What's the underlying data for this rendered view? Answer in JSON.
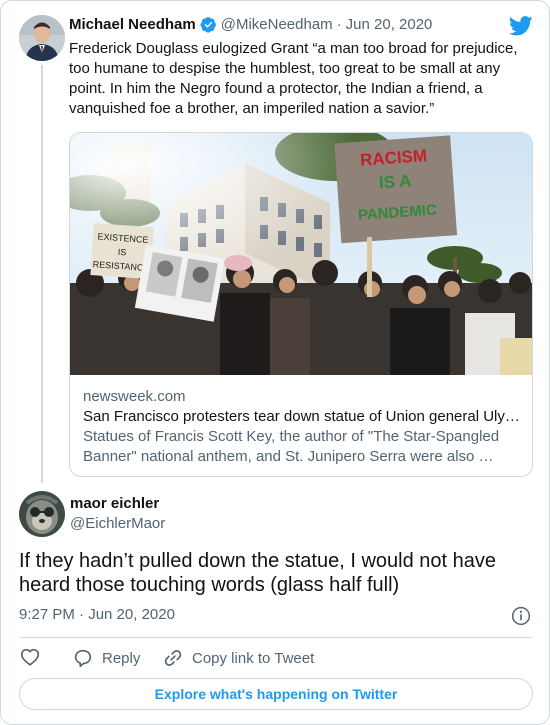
{
  "quoted_tweet": {
    "author_name": "Michael Needham",
    "handle": "@MikeNeedham",
    "separator": "·",
    "date": "Jun 20, 2020",
    "text": "Frederick Douglass eulogized Grant “a man too broad for prejudice, too humane to despise the humblest, too great to be small at any point. In him the Negro found a protector, the Indian a friend, a vanquished foe a brother, an imperiled nation a savior.”",
    "verified_icon": "verified-badge-icon",
    "link_card": {
      "domain": "newsweek.com",
      "title": "San Francisco protesters tear down statue of Union general Uly…",
      "description": "Statues of Francis Scott Key, the author of \"The Star-Spangled Banner\" national anthem, and St. Junipero Serra were also …",
      "sign_1": "RACISM IS A PANDEMIC",
      "sign_2": "EXISTENCE IS RESISTANCE"
    }
  },
  "tweet": {
    "author_name": "maor eichler",
    "handle": "@EichlerMaor",
    "text": "If they hadn’t pulled down the statue, I would not have heard those touching words (glass half full)",
    "time": "9:27 PM · Jun 20, 2020"
  },
  "actions": {
    "reply_label": "Reply",
    "copy_link_label": "Copy link to Tweet"
  },
  "explore_label": "Explore what's happening on Twitter",
  "colors": {
    "twitter_blue": "#1d9bf0",
    "text": "#0f1419",
    "secondary": "#536471",
    "border": "#cfd9de"
  }
}
